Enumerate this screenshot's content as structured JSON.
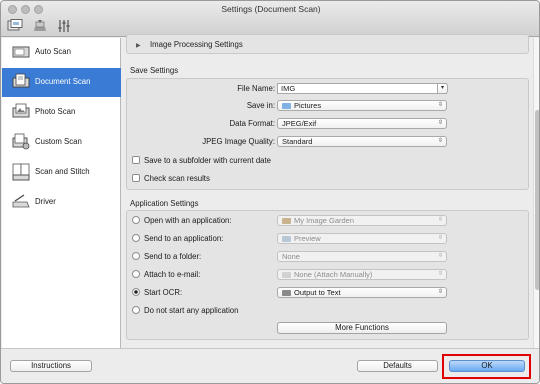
{
  "window": {
    "title": "Settings (Document Scan)"
  },
  "toolbar": {
    "icons": [
      "scan-from-computer-icon",
      "scanner-icon",
      "general-settings-icon"
    ]
  },
  "sidebar": {
    "items": [
      {
        "label": "Auto Scan",
        "icon": "auto-scan-icon"
      },
      {
        "label": "Document Scan",
        "icon": "document-scan-icon",
        "selected": true
      },
      {
        "label": "Photo Scan",
        "icon": "photo-scan-icon"
      },
      {
        "label": "Custom Scan",
        "icon": "custom-scan-icon"
      },
      {
        "label": "Scan and Stitch",
        "icon": "scan-stitch-icon"
      },
      {
        "label": "Driver",
        "icon": "driver-icon"
      }
    ]
  },
  "image_processing": {
    "label": "Image Processing Settings"
  },
  "save_settings": {
    "title": "Save Settings",
    "file_name_label": "File Name:",
    "file_name_value": "IMG",
    "save_in_label": "Save in:",
    "save_in_value": "Pictures",
    "data_format_label": "Data Format:",
    "data_format_value": "JPEG/Exif",
    "jpeg_quality_label": "JPEG Image Quality:",
    "jpeg_quality_value": "Standard",
    "subfolder_label": "Save to a subfolder with current date",
    "check_results_label": "Check scan results"
  },
  "app_settings": {
    "title": "Application Settings",
    "open_app_label": "Open with an application:",
    "open_app_value": "My Image Garden",
    "send_app_label": "Send to an application:",
    "send_app_value": "Preview",
    "send_folder_label": "Send to a folder:",
    "send_folder_value": "None",
    "attach_email_label": "Attach to e-mail:",
    "attach_email_value": "None (Attach Manually)",
    "start_ocr_label": "Start OCR:",
    "start_ocr_value": "Output to Text",
    "no_app_label": "Do not start any application",
    "more_functions_label": "More Functions",
    "selected_option": "start-ocr"
  },
  "footer": {
    "instructions_label": "Instructions",
    "defaults_label": "Defaults",
    "ok_label": "OK"
  },
  "colors": {
    "sidebar_selected": "#3a7bd5",
    "ok_highlight_frame": "#e00000"
  }
}
